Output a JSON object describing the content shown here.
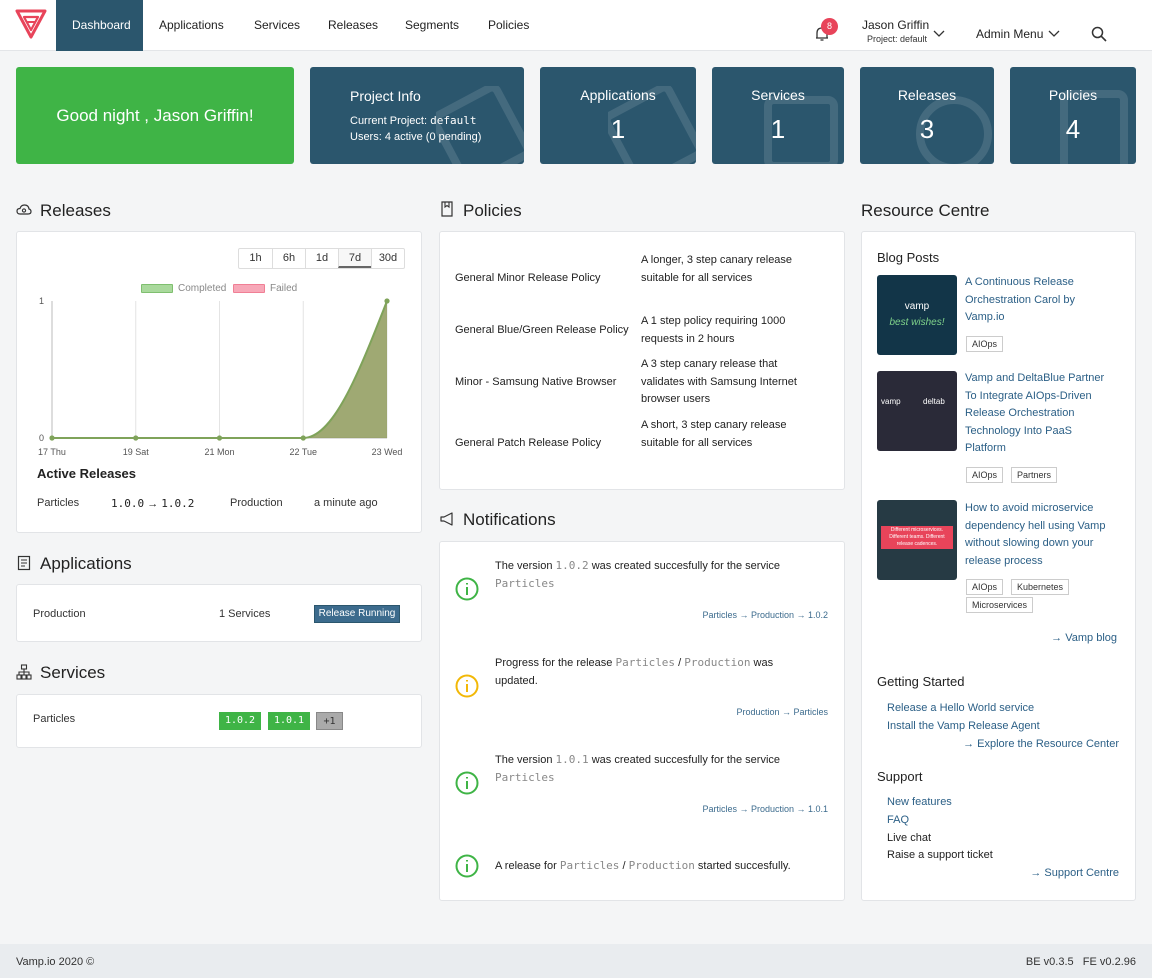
{
  "nav": {
    "tabs": [
      "Dashboard",
      "Applications",
      "Services",
      "Releases",
      "Segments",
      "Policies"
    ],
    "notification_count": "8",
    "user_name": "Jason Griffin",
    "user_project": "Project: default",
    "admin_menu": "Admin Menu"
  },
  "greeting": "Good night , Jason Griffin!",
  "project_info": {
    "title": "Project Info",
    "current_label": "Current Project: ",
    "current_value": "default",
    "users": "Users: 4 active (0 pending)"
  },
  "stats": [
    {
      "label": "Applications",
      "value": "1"
    },
    {
      "label": "Services",
      "value": "1"
    },
    {
      "label": "Releases",
      "value": "3"
    },
    {
      "label": "Policies",
      "value": "4"
    }
  ],
  "releases": {
    "heading": "Releases",
    "ranges": [
      "1h",
      "6h",
      "1d",
      "7d",
      "30d"
    ],
    "active_range": "7d",
    "legend": [
      "Completed",
      "Failed"
    ],
    "active_heading": "Active Releases",
    "active_row": {
      "service": "Particles",
      "from": "1.0.0",
      "to": "1.0.2",
      "env": "Production",
      "time": "a minute ago"
    }
  },
  "chart_data": {
    "type": "area",
    "x": [
      "17 Thu",
      "19 Sat",
      "21 Mon",
      "22 Tue",
      "23 Wed"
    ],
    "series": [
      {
        "name": "Completed",
        "values": [
          0,
          0,
          0,
          0,
          1
        ]
      },
      {
        "name": "Failed",
        "values": [
          0,
          0,
          0,
          0,
          0
        ]
      }
    ],
    "yticks": [
      "0",
      "1"
    ],
    "ylim": [
      0,
      1
    ],
    "legend_position": "top",
    "grid": true,
    "colors": {
      "Completed": "#8e9a5a",
      "Failed": "#f07f95"
    }
  },
  "applications": {
    "heading": "Applications",
    "rows": [
      {
        "name": "Production",
        "services": "1 Services",
        "status": "Release Running"
      }
    ]
  },
  "services": {
    "heading": "Services",
    "rows": [
      {
        "name": "Particles",
        "versions": [
          "1.0.2",
          "1.0.1",
          "+1"
        ]
      }
    ]
  },
  "policies": {
    "heading": "Policies",
    "rows": [
      {
        "name": "General Minor Release Policy",
        "desc": "A longer, 3 step canary release suitable for all services"
      },
      {
        "name": "General Blue/Green Release Policy",
        "desc": "A 1 step policy requiring 1000 requests in 2 hours"
      },
      {
        "name": "Minor - Samsung Native Browser",
        "desc": "A 3 step canary release that validates with Samsung Internet browser users"
      },
      {
        "name": "General Patch Release Policy",
        "desc": "A short, 3 step canary release suitable for all services"
      }
    ]
  },
  "notifications": {
    "heading": "Notifications",
    "items": [
      {
        "pre": "The version ",
        "code1": "1.0.2",
        "mid": " was created succesfully for the service ",
        "code2": "Particles",
        "post": "",
        "link": "Particles → Production → 1.0.2",
        "color": "#3fb446"
      },
      {
        "pre": "Progress for the release ",
        "code1": "Particles",
        "mid": " / ",
        "code2": "Production",
        "post": " was updated.",
        "link": "Production → Particles",
        "color": "#f2b807"
      },
      {
        "pre": "The version ",
        "code1": "1.0.1",
        "mid": " was created succesfully for the service ",
        "code2": "Particles",
        "post": "",
        "link": "Particles → Production → 1.0.1",
        "color": "#3fb446"
      },
      {
        "pre": "A release for ",
        "code1": "Particles",
        "mid": " / ",
        "code2": "Production",
        "post": " started succesfully.",
        "link": "",
        "color": "#3fb446"
      }
    ]
  },
  "resource_centre": {
    "heading": "Resource Centre",
    "blog_heading": "Blog Posts",
    "posts": [
      {
        "title": "A Continuous Release Orchestration Carol by Vamp.io",
        "tags": [
          "AIOps"
        ]
      },
      {
        "title": "Vamp and DeltaBlue Partner To Integrate AIOps-Driven Release Orchestration Technology Into PaaS Platform",
        "tags": [
          "AIOps",
          "Partners"
        ]
      },
      {
        "title": "How to avoid microservice dependency hell using Vamp without slowing down your release process",
        "tags": [
          "AIOps",
          "Kubernetes",
          "Microservices"
        ]
      }
    ],
    "blog_link": "→ Vamp blog",
    "thumb_texts": [
      "vamp",
      "best wishes!",
      "vamp",
      "deltab",
      "Different microservices. Different teams. Different release cadences."
    ],
    "getting_started_heading": "Getting Started",
    "getting_started": [
      "Release a Hello World service",
      "Install the Vamp Release Agent"
    ],
    "explore_link": "→ Explore the Resource Center",
    "support_heading": "Support",
    "support_links": [
      "New features",
      "FAQ"
    ],
    "support_plain": [
      "Live chat",
      "Raise a support ticket"
    ],
    "support_centre_link": "→ Support Centre"
  },
  "footer": {
    "left": "Vamp.io 2020 ©",
    "be": "BE v0.3.5",
    "fe": "FE v0.2.96"
  }
}
